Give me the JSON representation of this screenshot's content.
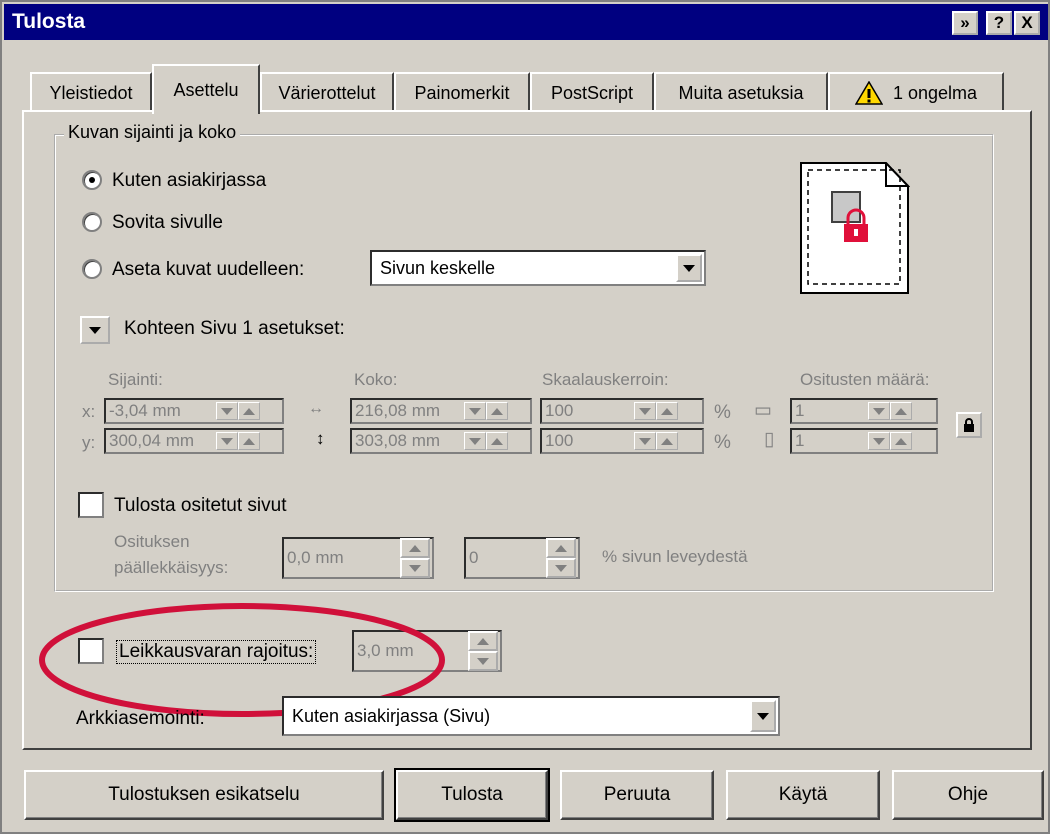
{
  "window": {
    "title": "Tulosta",
    "title_buttons": {
      "help": "?",
      "close": "X",
      "options": "»"
    }
  },
  "tabs": [
    {
      "label": "Yleistiedot",
      "active": false
    },
    {
      "label": "Asettelu",
      "active": true
    },
    {
      "label": "Värierottelut",
      "active": false
    },
    {
      "label": "Painomerkit",
      "active": false
    },
    {
      "label": "PostScript",
      "active": false
    },
    {
      "label": "Muita asetuksia",
      "active": false
    },
    {
      "label": "1 ongelma",
      "active": false,
      "icon": "warning-icon"
    }
  ],
  "image_group": {
    "title": "Kuvan sijainti ja koko",
    "options": [
      {
        "label": "Kuten asiakirjassa",
        "selected": true
      },
      {
        "label": "Sovita sivulle",
        "selected": false
      },
      {
        "label": "Aseta kuvat uudelleen:",
        "selected": false
      }
    ],
    "reposition_select": "Sivun keskelle",
    "settings_label": "Kohteen Sivu 1 asetukset:",
    "headers": {
      "position": "Sijainti:",
      "size": "Koko:",
      "scale": "Skaalauskerroin:",
      "tiles": "Ositusten määrä:"
    },
    "x_label": "x:",
    "y_label": "y:",
    "x_position": "-3,04 mm",
    "y_position": "300,04 mm",
    "width": "216,08 mm",
    "height": "303,08 mm",
    "scale_x": "100",
    "scale_y": "100",
    "percent": "%",
    "tiles_x": "1",
    "tiles_y": "1"
  },
  "tiling": {
    "checkbox_label": "Tulosta ositetut sivut",
    "checked": false,
    "overlap_label_line1": "Osituksen",
    "overlap_label_line2": "päällekkäisyys:",
    "overlap_value": "0,0 mm",
    "percent_value": "0",
    "percent_label": "% sivun leveydestä"
  },
  "bleed": {
    "checkbox_label": "Leikkausvaran rajoitus:",
    "checked": false,
    "value": "3,0 mm",
    "highlight_color": "#d0103a"
  },
  "sheet": {
    "label": "Arkkiasemointi:",
    "select": "Kuten asiakirjassa (Sivu)"
  },
  "buttons": {
    "preview": "Tulostuksen esikatselu",
    "print": "Tulosta",
    "cancel": "Peruuta",
    "apply": "Käytä",
    "help": "Ohje"
  },
  "colors": {
    "titlebar": "#000080",
    "face": "#d4d0c8",
    "lock": "#e0103a",
    "warning": "#ffd800"
  }
}
